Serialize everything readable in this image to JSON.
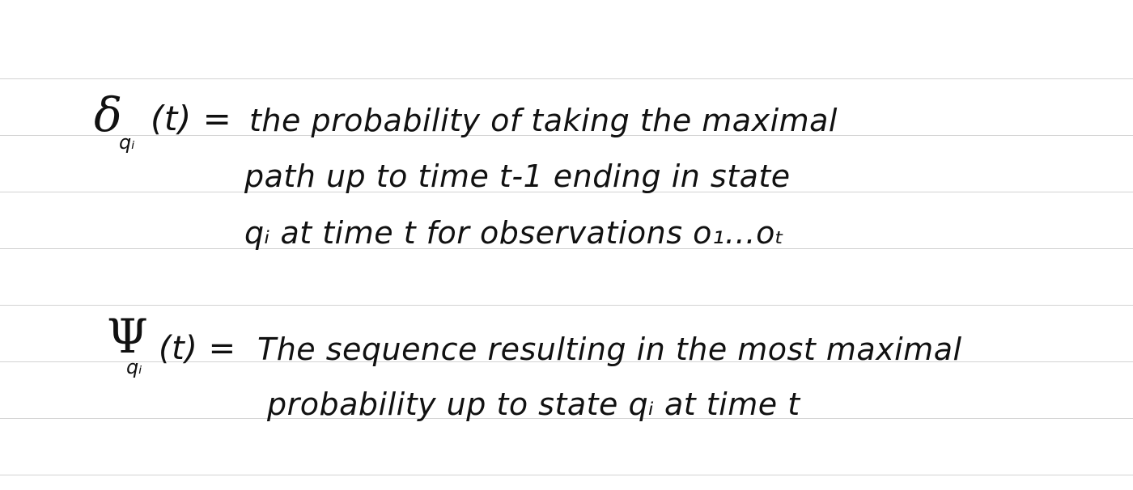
{
  "notes": {
    "delta": {
      "symbol": "δ",
      "subscript": "qᵢ",
      "argument": "(t) =",
      "lines": [
        "the probability of taking the maximal",
        "path up to time t-1 ending in state",
        "qᵢ at time t for observations o₁…oₜ"
      ]
    },
    "psi": {
      "symbol": "Ψ",
      "subscript": "qᵢ",
      "argument": "(t) =",
      "lines": [
        "The sequence resulting in the most maximal",
        "probability up to state qᵢ at time t"
      ]
    }
  }
}
